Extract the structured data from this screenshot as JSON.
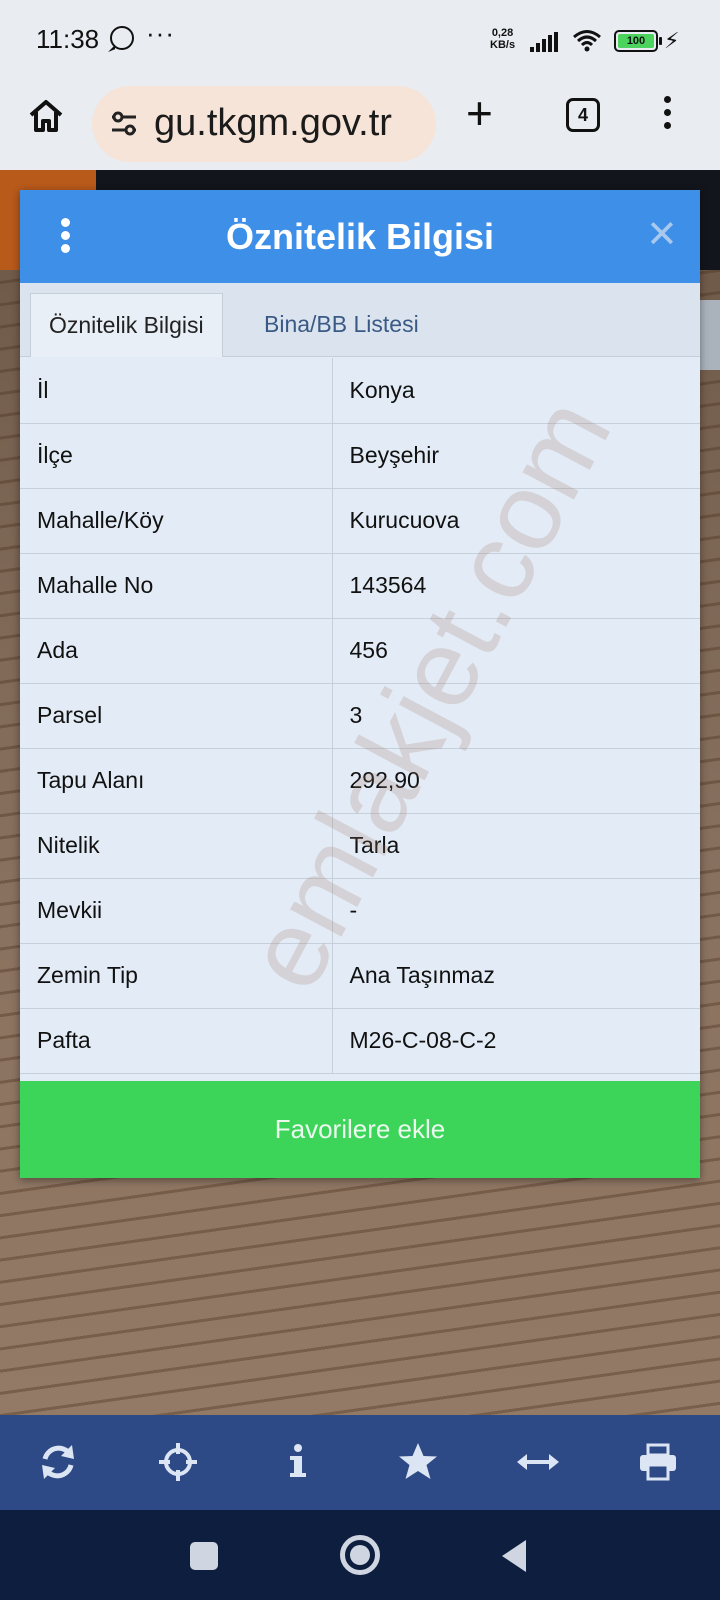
{
  "status_bar": {
    "time": "11:38",
    "more": "···",
    "net_speed_value": "0,28",
    "net_speed_unit": "KB/s",
    "battery": "100"
  },
  "browser": {
    "url": "gu.tkgm.gov.tr",
    "tab_count": "4"
  },
  "modal": {
    "title": "Öznitelik Bilgisi",
    "tabs": [
      {
        "label": "Öznitelik Bilgisi",
        "active": true
      },
      {
        "label": "Bina/BB Listesi",
        "active": false
      }
    ],
    "rows": [
      {
        "key": "İl",
        "value": "Konya"
      },
      {
        "key": "İlçe",
        "value": "Beyşehir"
      },
      {
        "key": "Mahalle/Köy",
        "value": "Kurucuova"
      },
      {
        "key": "Mahalle No",
        "value": "143564"
      },
      {
        "key": "Ada",
        "value": "456"
      },
      {
        "key": "Parsel",
        "value": "3"
      },
      {
        "key": "Tapu Alanı",
        "value": "292,90"
      },
      {
        "key": "Nitelik",
        "value": "Tarla"
      },
      {
        "key": "Mevkii",
        "value": "-"
      },
      {
        "key": "Zemin Tip",
        "value": "Ana Taşınmaz"
      },
      {
        "key": "Pafta",
        "value": "M26-C-08-C-2"
      }
    ],
    "favorite_button": "Favorilere ekle"
  },
  "watermark": "emlakjet.com",
  "toolbar_icons": [
    "refresh-icon",
    "locate-icon",
    "info-icon",
    "star-icon",
    "measure-icon",
    "print-icon"
  ],
  "colors": {
    "header_blue": "#3d8fe8",
    "favorite_green": "#3dd45a",
    "toolbar_blue": "#2d4a86"
  }
}
